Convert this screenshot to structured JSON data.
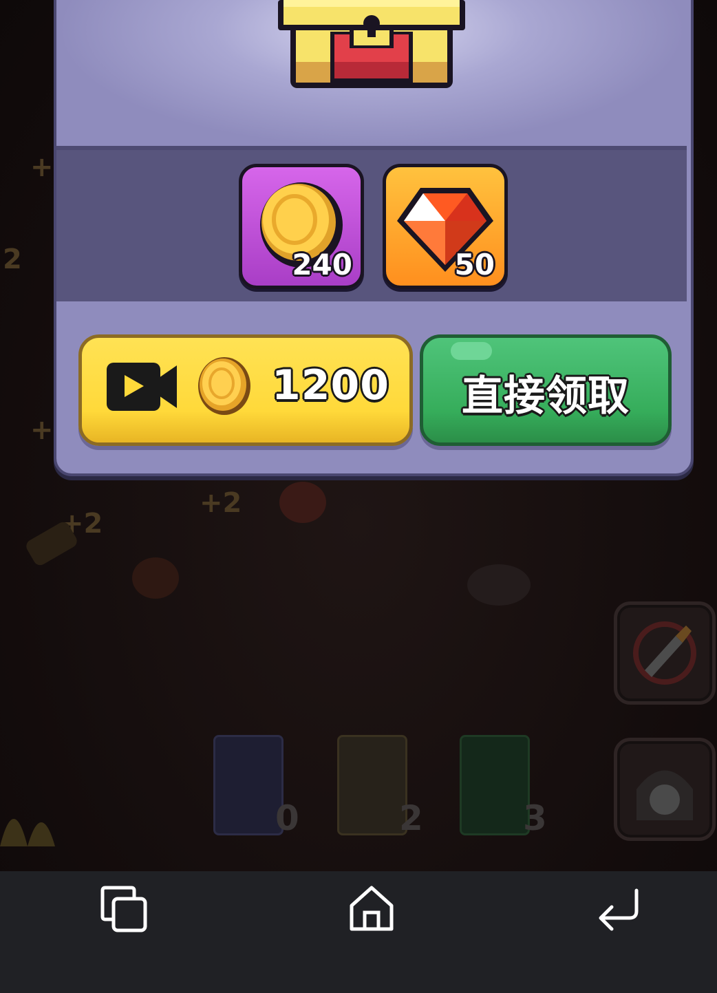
{
  "background": {
    "floating_texts": [
      "+2",
      "+2",
      "+",
      "+",
      "2"
    ],
    "book_counts": [
      "0",
      "2",
      "3"
    ]
  },
  "reward": {
    "items": [
      {
        "icon": "coin-icon",
        "count": "240"
      },
      {
        "icon": "ruby-gem-icon",
        "count": "50"
      }
    ]
  },
  "buttons": {
    "video_cost": "1200",
    "video_icon": "video-camera-icon",
    "claim_label": "直接领取"
  },
  "navbar": {
    "icons": [
      "recent-apps-icon",
      "home-icon",
      "back-icon"
    ]
  },
  "colors": {
    "panel": "#8f8cbd",
    "video_button": "#ffd93a",
    "claim_button": "#36ad5b",
    "navbar": "#202125"
  }
}
